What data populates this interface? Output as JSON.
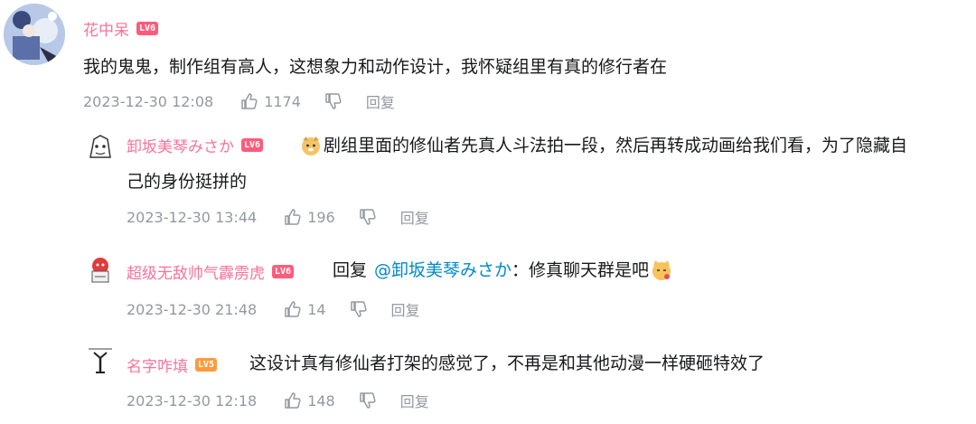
{
  "comments": [
    {
      "username": "花中呆",
      "level": "LV6",
      "text": "我的鬼鬼，制作组有高人，这想象力和动作设计，我怀疑组里有真的修行者在",
      "time": "2023-12-30 12:08",
      "likes": "1174",
      "reply_label": "回复"
    },
    {
      "username": "卸坂美琴みさか",
      "level": "LV6",
      "emoji": "dog-emoji",
      "text_line1": "剧组里面的修仙者先真人斗法拍一段，然后再转成动画给我们看，为了隐藏自",
      "text_line2": "己的身份挺拼的",
      "time": "2023-12-30 13:44",
      "likes": "196",
      "reply_label": "回复"
    },
    {
      "username": "超级无敌帅气霹雳虎",
      "level": "LV6",
      "reply_prefix": "回复",
      "mention": "@卸坂美琴みさか",
      "text": "：修真聊天群是吧",
      "emoji": "cat-emoji",
      "time": "2023-12-30 21:48",
      "likes": "14",
      "reply_label": "回复"
    },
    {
      "username": "名字咋填",
      "level": "LV5",
      "text": "这设计真有修仙者打架的感觉了，不再是和其他动漫一样硬砸特效了",
      "time": "2023-12-30 12:18",
      "likes": "148",
      "reply_label": "回复"
    }
  ],
  "colors": {
    "username": "#fb7299",
    "meta": "#9499a0",
    "mention": "#008ac5",
    "lv6": "#ff5c7c",
    "lv5": "#ff9b3d"
  }
}
